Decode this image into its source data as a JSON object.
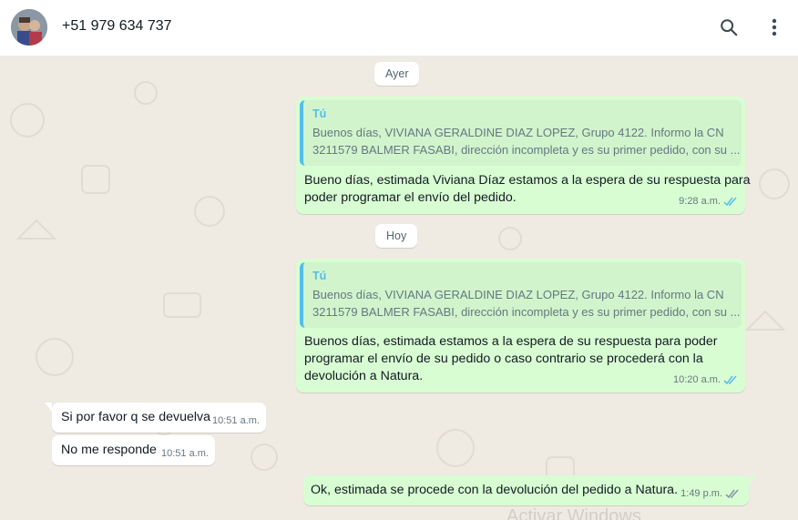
{
  "header": {
    "contact_name": "+51 979 634 737",
    "icons": [
      "avatar",
      "search-icon",
      "more-vert-icon"
    ]
  },
  "dates": {
    "yesterday": "Ayer",
    "today": "Hoy"
  },
  "messages": [
    {
      "direction": "out",
      "quote": {
        "author": "Tú",
        "line1": "Buenos días, VIVIANA GERALDINE DIAZ LOPEZ, Grupo 4122. Informo la CN",
        "line2": "3211579 BALMER FASABI, dirección incompleta y es su primer pedido, con su ..."
      },
      "text_line1": "Bueno días, estimada Viviana Díaz estamos a la espera de su respuesta para",
      "text_line2": "poder programar el envío del pedido.",
      "time": "9:28 a.m.",
      "status": "read"
    },
    {
      "direction": "out",
      "quote": {
        "author": "Tú",
        "line1": "Buenos días, VIVIANA GERALDINE DIAZ LOPEZ, Grupo 4122. Informo la CN",
        "line2": "3211579 BALMER FASABI, dirección incompleta y es su primer pedido, con su ..."
      },
      "text_line1": "Buenos días, estimada estamos a la espera de su respuesta para poder",
      "text_line2": "programar el envío de su pedido o caso contrario se procederá con la",
      "text_line3": "devolución a Natura.",
      "time": "10:20 a.m.",
      "status": "read"
    },
    {
      "direction": "in",
      "text": "Si por favor q se devuelva",
      "time": "10:51 a.m."
    },
    {
      "direction": "in",
      "text": "No me responde",
      "time": "10:51 a.m."
    },
    {
      "direction": "out",
      "text": "Ok, estimada se procede con la devolución del pedido a Natura.",
      "time": "1:49 p.m.",
      "status": "delivered"
    }
  ],
  "watermark": "Activar Windows",
  "colors": {
    "outgoing_bubble": "#d9fdd3",
    "incoming_bubble": "#ffffff",
    "read_ticks": "#53bdeb",
    "delivered_ticks": "#8696a0",
    "wallpaper": "#efeae2"
  }
}
